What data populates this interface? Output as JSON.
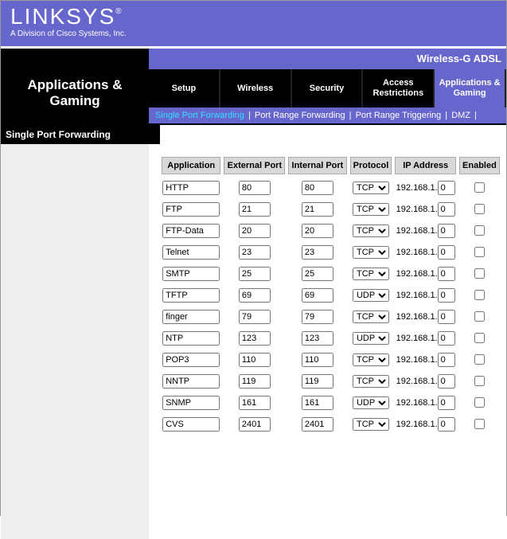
{
  "brand": {
    "name": "LINKSYS",
    "reg": "®",
    "subtitle": "A Division of Cisco Systems, Inc."
  },
  "device_name": "Wireless-G ADSL",
  "section_title": "Applications & Gaming",
  "tabs": [
    {
      "label": "Setup"
    },
    {
      "label": "Wireless"
    },
    {
      "label": "Security"
    },
    {
      "label": "Access Restrictions"
    },
    {
      "label": "Applications & Gaming",
      "active": true
    }
  ],
  "subtabs": [
    {
      "label": "Single Port Forwarding",
      "active": true
    },
    {
      "label": "Port Range Forwarding"
    },
    {
      "label": "Port Range Triggering"
    },
    {
      "label": "DMZ"
    }
  ],
  "panel_title": "Single Port Forwarding",
  "headers": {
    "application": "Application",
    "external": "External Port",
    "internal": "Internal Port",
    "protocol": "Protocol",
    "ip": "IP Address",
    "enabled": "Enabled"
  },
  "ip_prefix": "192.168.1.",
  "protocol_options": [
    "TCP",
    "UDP"
  ],
  "rows": [
    {
      "app": "HTTP",
      "ext": "80",
      "int": "80",
      "proto": "TCP",
      "ip_end": "0",
      "enabled": false
    },
    {
      "app": "FTP",
      "ext": "21",
      "int": "21",
      "proto": "TCP",
      "ip_end": "0",
      "enabled": false
    },
    {
      "app": "FTP-Data",
      "ext": "20",
      "int": "20",
      "proto": "TCP",
      "ip_end": "0",
      "enabled": false
    },
    {
      "app": "Telnet",
      "ext": "23",
      "int": "23",
      "proto": "TCP",
      "ip_end": "0",
      "enabled": false
    },
    {
      "app": "SMTP",
      "ext": "25",
      "int": "25",
      "proto": "TCP",
      "ip_end": "0",
      "enabled": false
    },
    {
      "app": "TFTP",
      "ext": "69",
      "int": "69",
      "proto": "UDP",
      "ip_end": "0",
      "enabled": false
    },
    {
      "app": "finger",
      "ext": "79",
      "int": "79",
      "proto": "TCP",
      "ip_end": "0",
      "enabled": false
    },
    {
      "app": "NTP",
      "ext": "123",
      "int": "123",
      "proto": "UDP",
      "ip_end": "0",
      "enabled": false
    },
    {
      "app": "POP3",
      "ext": "110",
      "int": "110",
      "proto": "TCP",
      "ip_end": "0",
      "enabled": false
    },
    {
      "app": "NNTP",
      "ext": "119",
      "int": "119",
      "proto": "TCP",
      "ip_end": "0",
      "enabled": false
    },
    {
      "app": "SNMP",
      "ext": "161",
      "int": "161",
      "proto": "UDP",
      "ip_end": "0",
      "enabled": false
    },
    {
      "app": "CVS",
      "ext": "2401",
      "int": "2401",
      "proto": "TCP",
      "ip_end": "0",
      "enabled": false
    }
  ]
}
